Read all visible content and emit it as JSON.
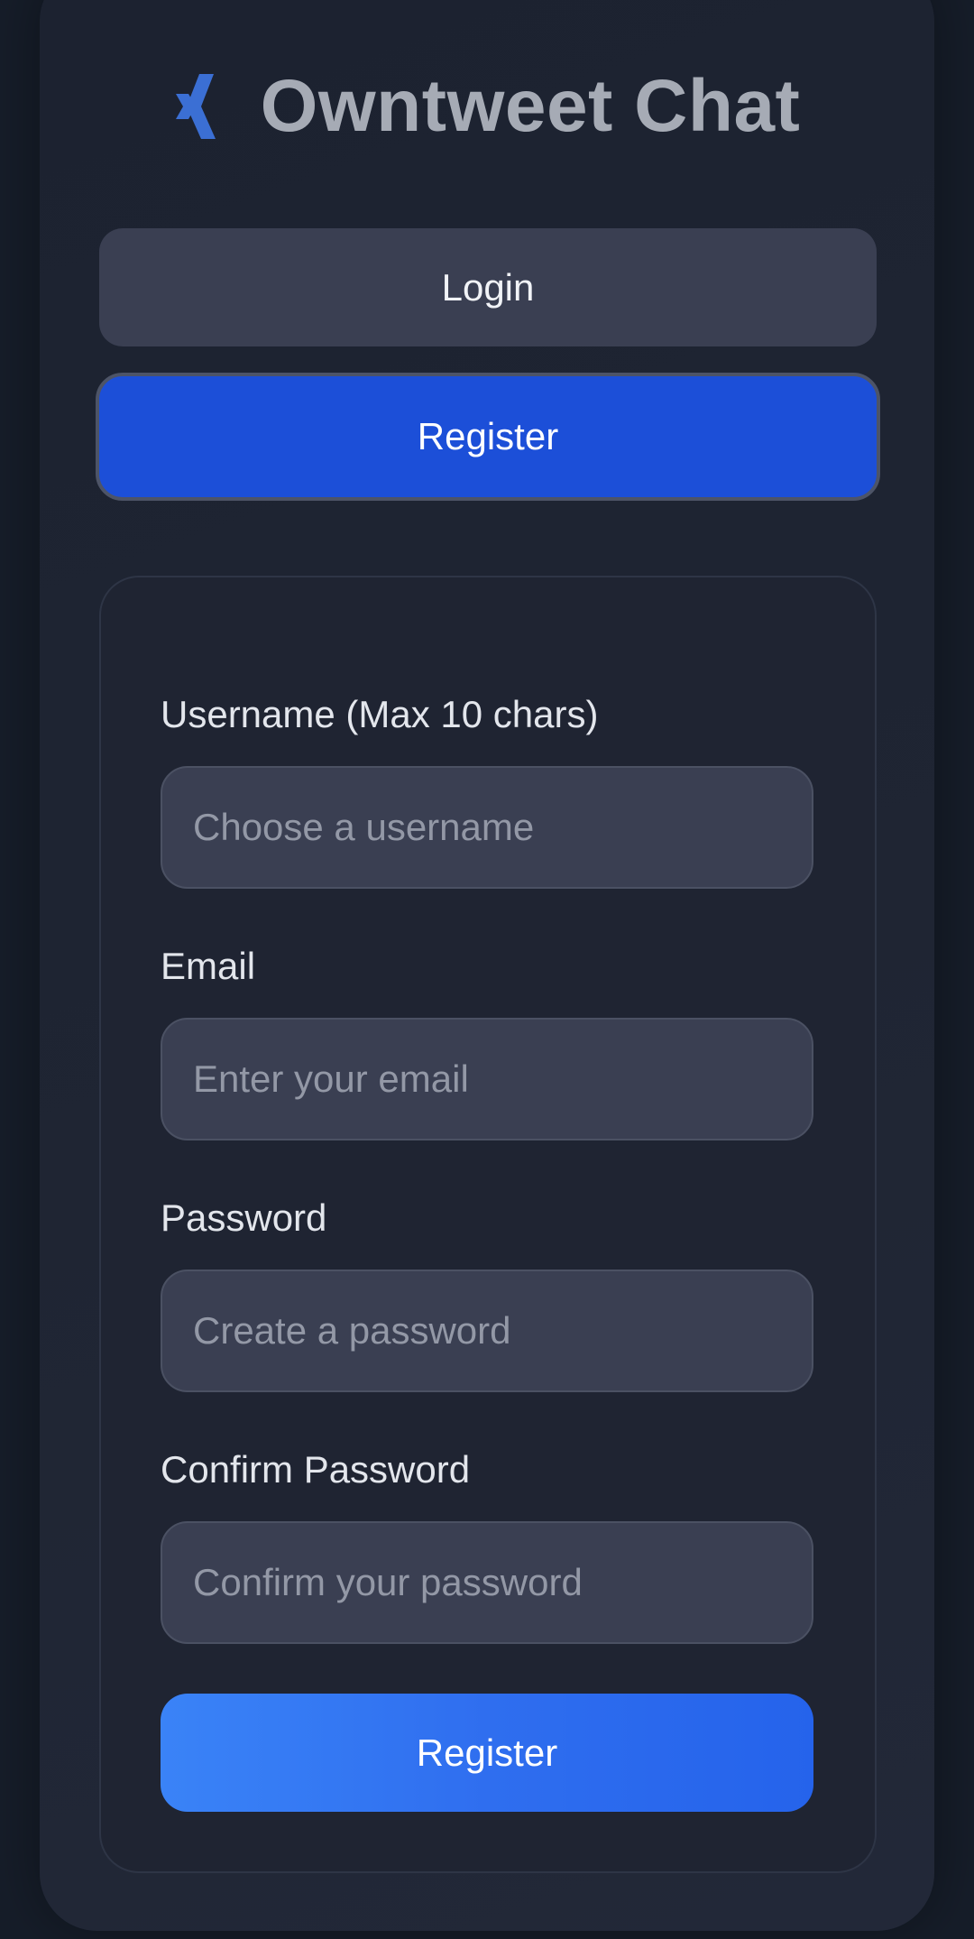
{
  "app": {
    "title": "Owntweet Chat",
    "logo_icon": "x-logo-icon",
    "accent_color": "#3b6fd4"
  },
  "tabs": {
    "login_label": "Login",
    "register_label": "Register",
    "active": "register"
  },
  "form": {
    "fields": [
      {
        "label": "Username (Max 10 chars)",
        "placeholder": "Choose a username",
        "value": ""
      },
      {
        "label": "Email",
        "placeholder": "Enter your email",
        "value": ""
      },
      {
        "label": "Password",
        "placeholder": "Create a password",
        "value": ""
      },
      {
        "label": "Confirm Password",
        "placeholder": "Confirm your password",
        "value": ""
      }
    ],
    "submit_label": "Register"
  },
  "colors": {
    "background": "#161d29",
    "card": "#1f2533",
    "tab_inactive": "#3a3f52",
    "tab_active": "#1c4fd8",
    "submit_gradient_start": "#3a83f7",
    "submit_gradient_end": "#2563eb"
  }
}
